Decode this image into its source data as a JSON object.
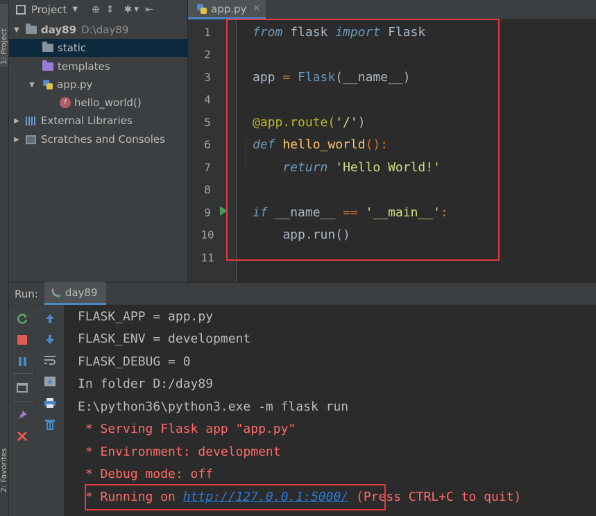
{
  "side_tabs": {
    "project": "1: Project",
    "favorites": "2: Favorites"
  },
  "project_panel": {
    "title": "Project",
    "tree": [
      {
        "label": "day89",
        "path": "D:\\day89"
      },
      {
        "label": "static"
      },
      {
        "label": "templates"
      },
      {
        "label": "app.py"
      },
      {
        "label": "hello_world()"
      },
      {
        "label": "External Libraries"
      },
      {
        "label": "Scratches and Consoles"
      }
    ]
  },
  "editor": {
    "tab_label": "app.py",
    "line_numbers": [
      "1",
      "2",
      "3",
      "4",
      "5",
      "6",
      "7",
      "8",
      "9",
      "10",
      "11"
    ],
    "code": {
      "l1_from": "from",
      "l1_module": " flask ",
      "l1_import": "import",
      "l1_name": " Flask",
      "l3_var": "app ",
      "l3_eq": "=",
      "l3_cls": " Flask",
      "l3_args": "(__name__)",
      "l5_decorator": "@app.route(",
      "l5_str": "'/'",
      "l5_close": ")",
      "l6_def": "def",
      "l6_fn": " hello_world",
      "l6_rest": "():",
      "l7_indent": "    ",
      "l7_return": "return",
      "l7_str": " 'Hello World!'",
      "l9_if": "if",
      "l9_name": " __name__ ",
      "l9_op": "==",
      "l9_str": " '__main__'",
      "l9_colon": ":",
      "l10_code": "    app.run()"
    }
  },
  "run_panel": {
    "label": "Run:",
    "tab": "day89",
    "output": [
      "FLASK_APP = app.py",
      "FLASK_ENV = development",
      "FLASK_DEBUG = 0",
      "In folder D:/day89",
      "E:\\python36\\python3.exe -m flask run",
      " * Serving Flask app \"app.py\"",
      " * Environment: development",
      " * Debug mode: off"
    ],
    "running_prefix": " * Running on ",
    "running_url": "http://127.0.0.1:5000/",
    "running_suffix": " (Press CTRL+C to quit)"
  },
  "colors": {
    "highlight_border": "#e0393e",
    "accent": "#4a88c7",
    "keyword": "#6897bb",
    "function": "#ffc66d",
    "string": "#cdde82",
    "error_text": "#ff6b68",
    "link": "#287bde"
  }
}
